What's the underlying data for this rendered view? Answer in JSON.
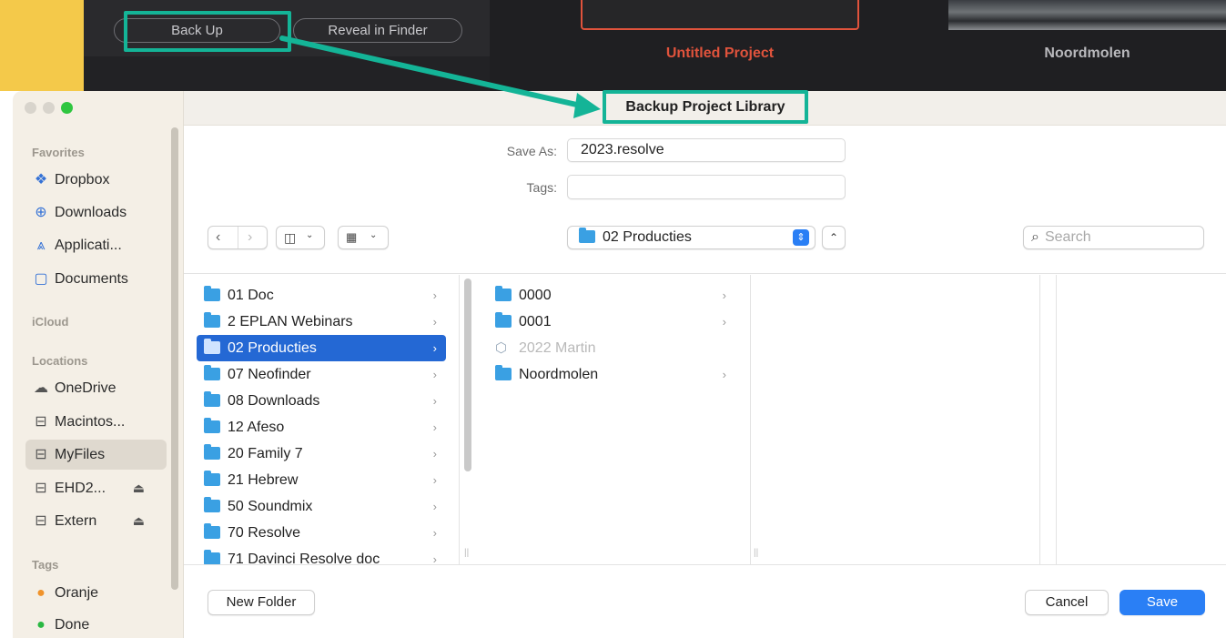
{
  "background_app": {
    "backup_button": "Back Up",
    "reveal_button": "Reveal in Finder",
    "project1_name": "Untitled Project",
    "project2_name": "Noordmolen"
  },
  "annotation": {
    "label": "Backup Project Library",
    "color": "#14b497"
  },
  "sidebar": {
    "favorites_header": "Favorites",
    "favorites": [
      {
        "label": "Dropbox",
        "icon": "dropbox-icon"
      },
      {
        "label": "Downloads",
        "icon": "download-circle-icon"
      },
      {
        "label": "Applicati...",
        "icon": "applications-icon"
      },
      {
        "label": "Documents",
        "icon": "document-icon"
      }
    ],
    "icloud_header": "iCloud",
    "locations_header": "Locations",
    "locations": [
      {
        "label": "OneDrive",
        "icon": "cloud-icon"
      },
      {
        "label": "Macintos...",
        "icon": "drive-icon"
      },
      {
        "label": "MyFiles",
        "icon": "drive-icon"
      },
      {
        "label": "EHD2...",
        "icon": "drive-icon"
      },
      {
        "label": "Extern",
        "icon": "drive-icon"
      }
    ],
    "tags_header": "Tags",
    "tags": [
      {
        "label": "Oranje",
        "color": "#f0932b"
      },
      {
        "label": "Done",
        "color": "#2ab843"
      }
    ]
  },
  "form": {
    "save_as_label": "Save As:",
    "save_as_value": "2023.resolve",
    "tags_label": "Tags:",
    "tags_value": ""
  },
  "toolbar": {
    "location": "02 Producties",
    "search_placeholder": "Search"
  },
  "column1": [
    {
      "name": "01 Doc",
      "selected": false
    },
    {
      "name": "2 EPLAN Webinars",
      "selected": false
    },
    {
      "name": "02 Producties",
      "selected": true
    },
    {
      "name": "07 Neofinder",
      "selected": false
    },
    {
      "name": "08 Downloads",
      "selected": false
    },
    {
      "name": "12 Afeso",
      "selected": false
    },
    {
      "name": "20 Family 7",
      "selected": false
    },
    {
      "name": "21 Hebrew",
      "selected": false
    },
    {
      "name": "50 Soundmix",
      "selected": false
    },
    {
      "name": "70 Resolve",
      "selected": false
    },
    {
      "name": "71 Davinci Resolve doc",
      "selected": false
    }
  ],
  "column2": [
    {
      "name": "0000",
      "kind": "folder",
      "disabled": false
    },
    {
      "name": "0001",
      "kind": "folder",
      "disabled": false
    },
    {
      "name": "2022 Martin",
      "kind": "package",
      "disabled": true
    },
    {
      "name": "Noordmolen",
      "kind": "folder",
      "disabled": false
    }
  ],
  "footer": {
    "new_folder": "New Folder",
    "cancel": "Cancel",
    "save": "Save"
  },
  "colors": {
    "accent_blue": "#2468d4",
    "save_blue": "#2a7ff5",
    "highlight_red": "#e0533c"
  }
}
